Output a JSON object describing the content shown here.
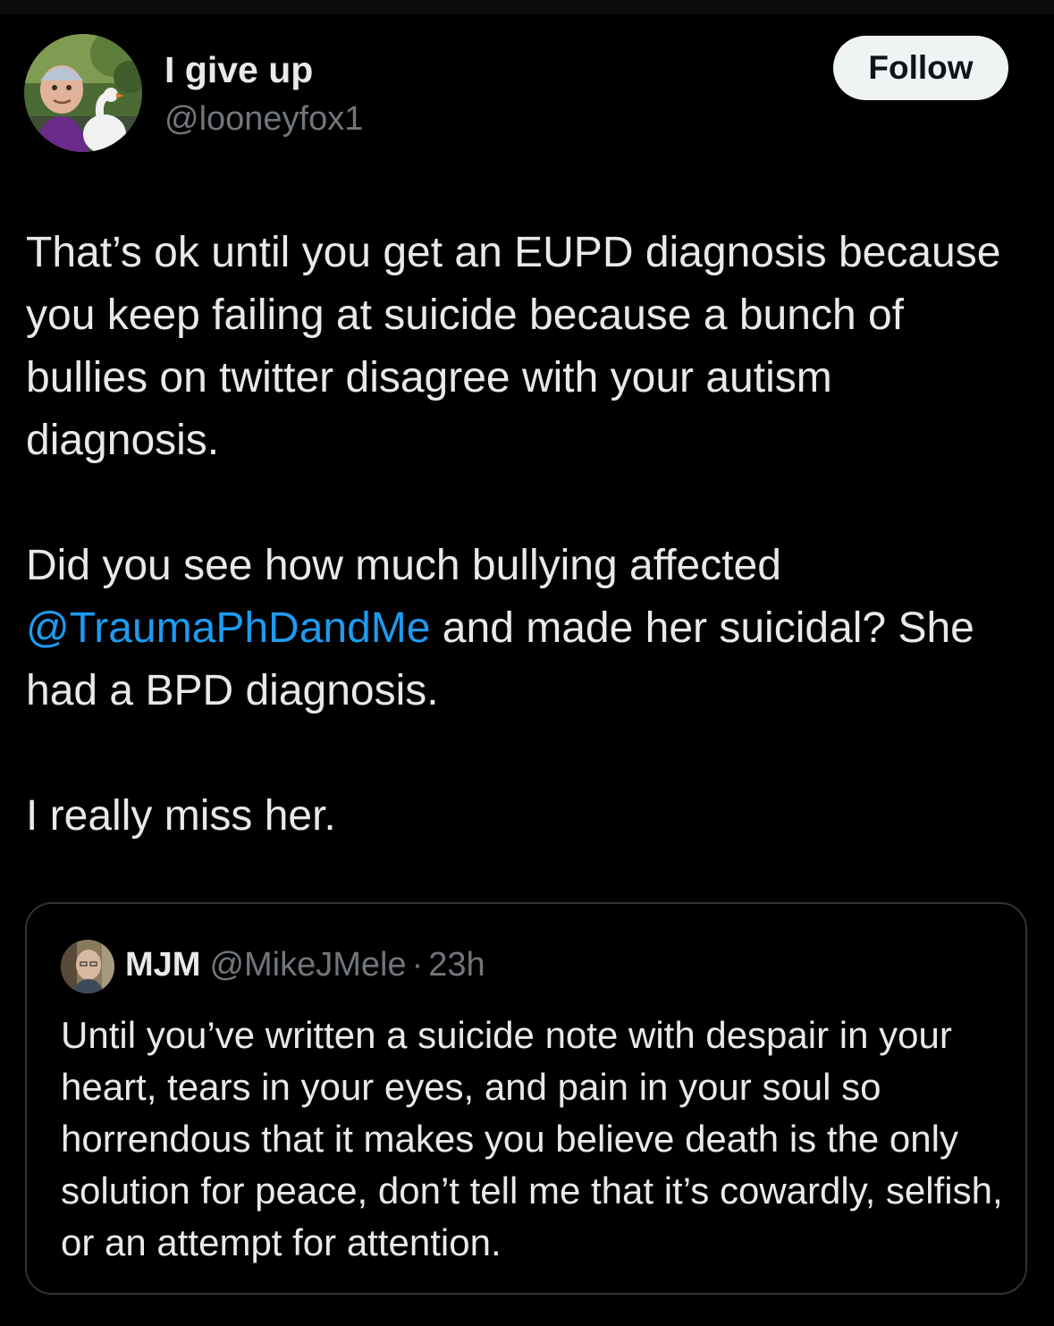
{
  "tweet": {
    "author": {
      "display_name": "I give up",
      "handle": "@looneyfox1",
      "avatar_icon": "profile-photo-with-swan"
    },
    "follow_label": "Follow",
    "paragraph1": "That’s ok until you get an EUPD diagnosis because you keep failing at suicide because a bunch of bullies on twitter disagree with your autism diagnosis.",
    "paragraph2_before": "Did you see how much bullying affected ",
    "paragraph2_mention": "@TraumaPhDandMe",
    "paragraph2_after": " and made her suicidal?  She had a BPD diagnosis.",
    "paragraph3": "I really miss her."
  },
  "quote": {
    "display_name": "MJM",
    "handle": "@MikeJMele",
    "separator": "·",
    "time": "23h",
    "avatar_icon": "profile-photo-man",
    "text": "Until you’ve written a suicide note with despair in your heart, tears in your eyes, and pain in your soul so horrendous that it makes you believe death is the only solution for peace, don’t tell me that it’s cowardly, selfish, or an attempt for attention."
  },
  "colors": {
    "background": "#000000",
    "text_primary": "#e7e9ea",
    "text_secondary": "#71767b",
    "mention": "#1d9bf0",
    "follow_button_bg": "#eff3f4",
    "border": "#2f3336"
  }
}
